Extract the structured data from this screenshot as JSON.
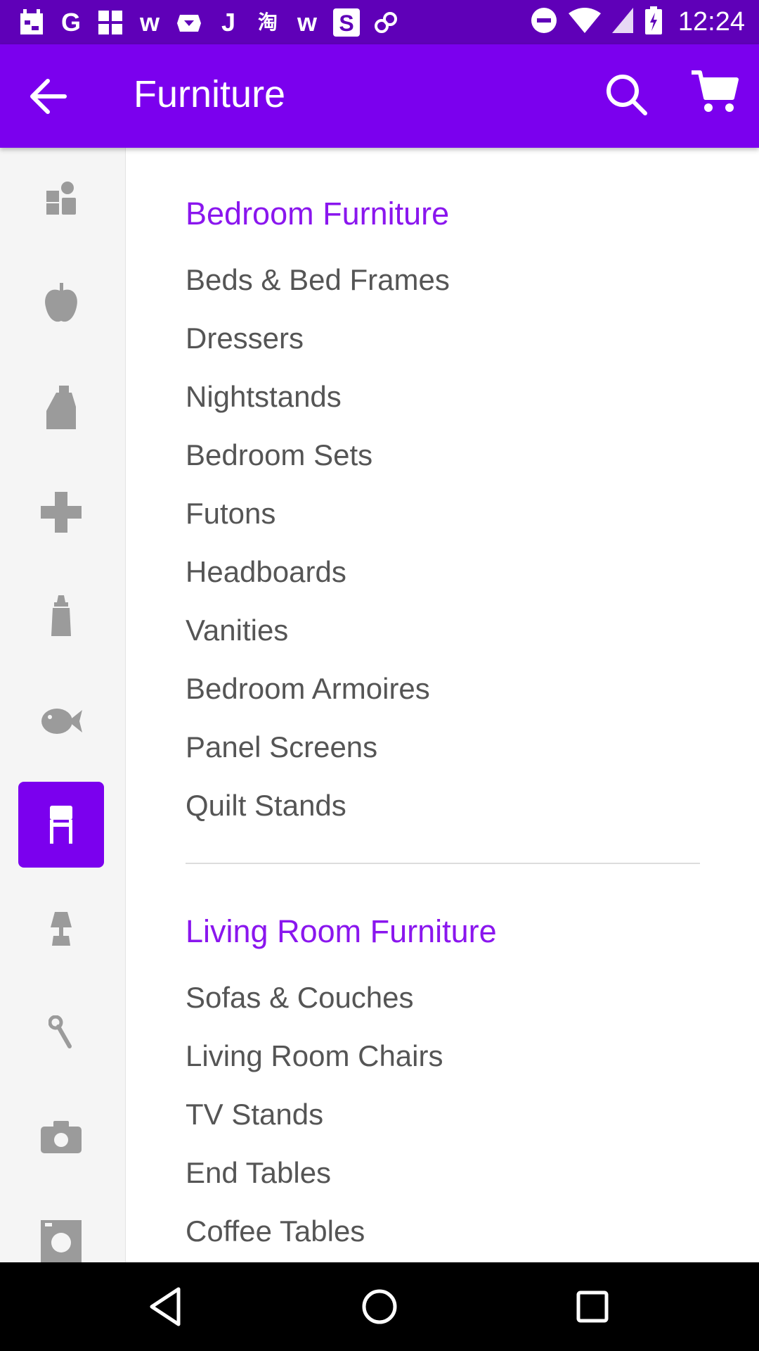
{
  "status_bar": {
    "time": "12:24",
    "notification_icons": [
      "calendar-icon",
      "google-icon",
      "grid-icon",
      "w-icon",
      "box-icon",
      "j-icon",
      "taobao-icon",
      "w-icon",
      "s-icon",
      "link-icon"
    ],
    "system_icons": [
      "do-not-disturb-icon",
      "wifi-icon",
      "signal-icon",
      "battery-icon"
    ]
  },
  "app_bar": {
    "title": "Furniture",
    "color": "#7b00ee"
  },
  "sidebar": {
    "items": [
      {
        "icon": "toys-icon",
        "active": false
      },
      {
        "icon": "apple-icon",
        "active": false
      },
      {
        "icon": "detergent-icon",
        "active": false
      },
      {
        "icon": "plus-cross-icon",
        "active": false
      },
      {
        "icon": "baby-bottle-icon",
        "active": false
      },
      {
        "icon": "fish-icon",
        "active": false
      },
      {
        "icon": "chair-icon",
        "active": true
      },
      {
        "icon": "lamp-icon",
        "active": false
      },
      {
        "icon": "wrench-icon",
        "active": false
      },
      {
        "icon": "camera-icon",
        "active": false
      },
      {
        "icon": "washer-icon",
        "active": false
      }
    ]
  },
  "sections": [
    {
      "title": "Bedroom Furniture",
      "items": [
        "Beds & Bed Frames",
        "Dressers",
        "Nightstands",
        "Bedroom Sets",
        "Futons",
        "Headboards",
        "Vanities",
        "Bedroom Armoires",
        "Panel Screens",
        "Quilt Stands"
      ]
    },
    {
      "title": "Living Room Furniture",
      "items": [
        "Sofas & Couches",
        "Living Room Chairs",
        "TV Stands",
        "End Tables",
        "Coffee Tables"
      ]
    }
  ],
  "nav_bar": {
    "buttons": [
      "back-nav-icon",
      "home-nav-icon",
      "recents-nav-icon"
    ]
  },
  "colors": {
    "status_bar": "#5f00b8",
    "accent": "#7b00ee",
    "heading": "#8a16ee",
    "item_text": "#555555"
  }
}
